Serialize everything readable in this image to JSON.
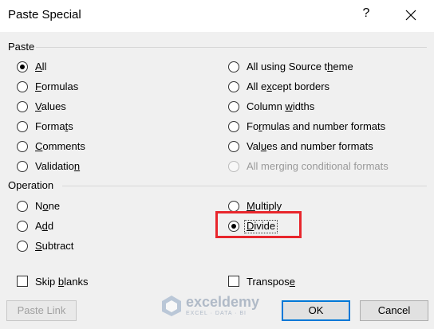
{
  "dialog": {
    "title": "Paste Special",
    "help_glyph": "?",
    "close_glyph": "close-icon"
  },
  "paste": {
    "section_label": "Paste",
    "left_options": [
      {
        "pre": "",
        "ul": "A",
        "post": "ll",
        "selected": true
      },
      {
        "pre": "",
        "ul": "F",
        "post": "ormulas",
        "selected": false
      },
      {
        "pre": "",
        "ul": "V",
        "post": "alues",
        "selected": false
      },
      {
        "pre": "Forma",
        "ul": "t",
        "post": "s",
        "selected": false
      },
      {
        "pre": "",
        "ul": "C",
        "post": "omments",
        "selected": false
      },
      {
        "pre": "Validatio",
        "ul": "n",
        "post": "",
        "selected": false
      }
    ],
    "right_options": [
      {
        "pre": "All using Source t",
        "ul": "h",
        "post": "eme",
        "disabled": false
      },
      {
        "pre": "All e",
        "ul": "x",
        "post": "cept borders",
        "disabled": false
      },
      {
        "pre": "Column ",
        "ul": "w",
        "post": "idths",
        "disabled": false
      },
      {
        "pre": "Fo",
        "ul": "r",
        "post": "mulas and number formats",
        "disabled": false
      },
      {
        "pre": "Val",
        "ul": "u",
        "post": "es and number formats",
        "disabled": false
      },
      {
        "pre": "All merging conditional formats",
        "ul": "",
        "post": "",
        "disabled": true
      }
    ]
  },
  "operation": {
    "section_label": "Operation",
    "left_options": [
      {
        "pre": "N",
        "ul": "o",
        "post": "ne",
        "selected": false
      },
      {
        "pre": "A",
        "ul": "d",
        "post": "d",
        "selected": false
      },
      {
        "pre": "",
        "ul": "S",
        "post": "ubtract",
        "selected": false
      }
    ],
    "right_options": [
      {
        "pre": "",
        "ul": "M",
        "post": "ultiply",
        "selected": false
      },
      {
        "pre": "",
        "ul": "D",
        "post": "ivide",
        "selected": true
      }
    ]
  },
  "checkboxes": {
    "skip_blanks": {
      "pre": "Skip ",
      "ul": "b",
      "post": "lanks",
      "checked": false
    },
    "transpose": {
      "pre": "Transpos",
      "ul": "e",
      "post": "",
      "checked": false
    }
  },
  "buttons": {
    "paste_link": "Paste Link",
    "ok": "OK",
    "cancel": "Cancel"
  },
  "watermark": {
    "name": "exceldemy",
    "tagline": "EXCEL · DATA · BI"
  },
  "colors": {
    "highlight": "#e8262c",
    "default_button_border": "#0078d7"
  }
}
